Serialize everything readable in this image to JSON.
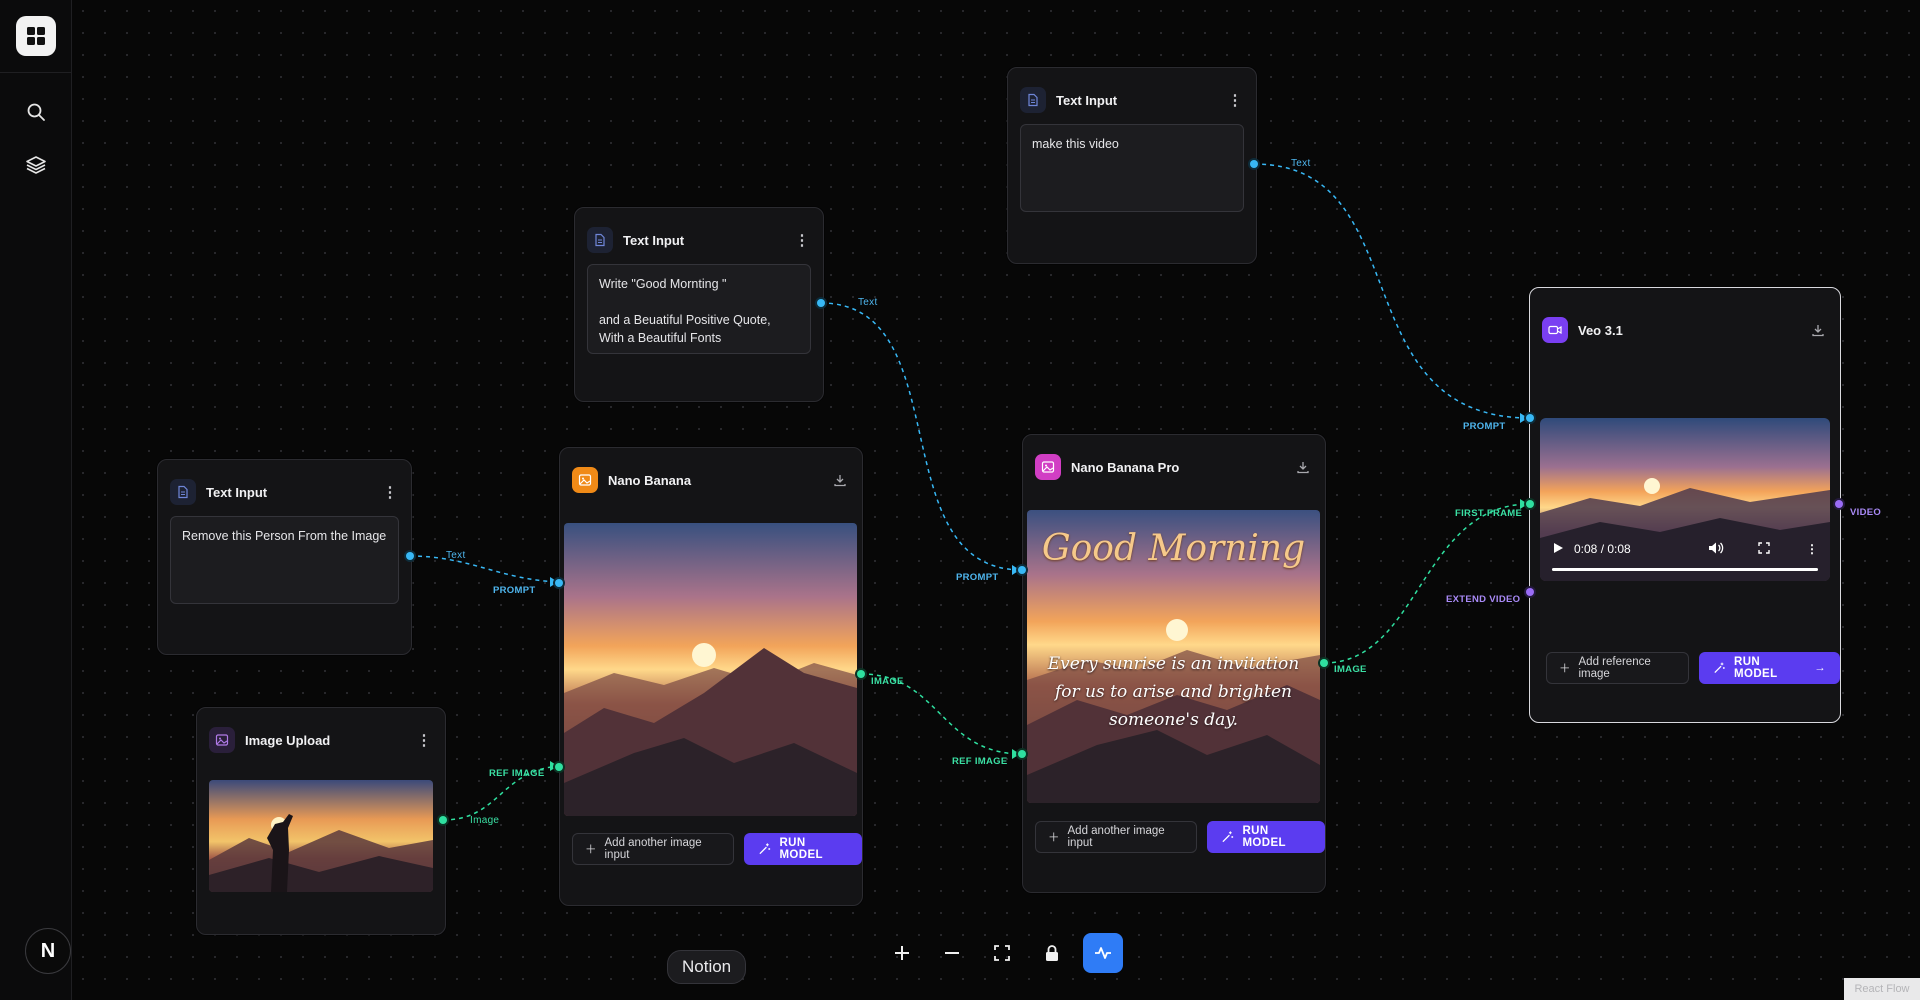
{
  "sidebar": {
    "badge_letter": "N"
  },
  "nodes": {
    "text_input_1": {
      "title": "Text Input",
      "value": "make this video"
    },
    "text_input_2": {
      "title": "Text Input",
      "value": "Write \"Good Mornting \"\n\nand a Beuatiful Positive Quote,\nWith a Beautiful Fonts"
    },
    "text_input_3": {
      "title": "Text Input",
      "value": "Remove this Person From the Image"
    },
    "image_upload": {
      "title": "Image Upload"
    },
    "nano_banana": {
      "title": "Nano Banana",
      "add_input_label": "Add another image input",
      "run_label": "RUN MODEL"
    },
    "nano_banana_pro": {
      "title": "Nano Banana Pro",
      "add_input_label": "Add another image input",
      "run_label": "RUN MODEL",
      "overlay_heading": "Good Morning",
      "overlay_quote": "Every sunrise is an invitation\nfor us to arise and brighten\nsomeone's day."
    },
    "veo": {
      "title": "Veo 3.1",
      "time": "0:08 / 0:08",
      "video_progress": 1.0,
      "add_ref_label": "Add reference image",
      "run_label": "RUN MODEL"
    }
  },
  "edge_labels": {
    "text": "Text",
    "image": "Image",
    "prompt": "PROMPT",
    "ref_image": "REF IMAGE",
    "image_caps": "IMAGE",
    "first_frame": "FIRST FRAME",
    "extend_video": "EXTEND VIDEO",
    "video": "VIDEO"
  },
  "tooltip": "Notion",
  "watermark": "React Flow",
  "colors": {
    "edge_text": "#38b8f5",
    "edge_image": "#2fe0a0",
    "edge_video": "#9a6cf6",
    "run_button": "#5b3cf0",
    "active_tool": "#2f7cf6"
  }
}
